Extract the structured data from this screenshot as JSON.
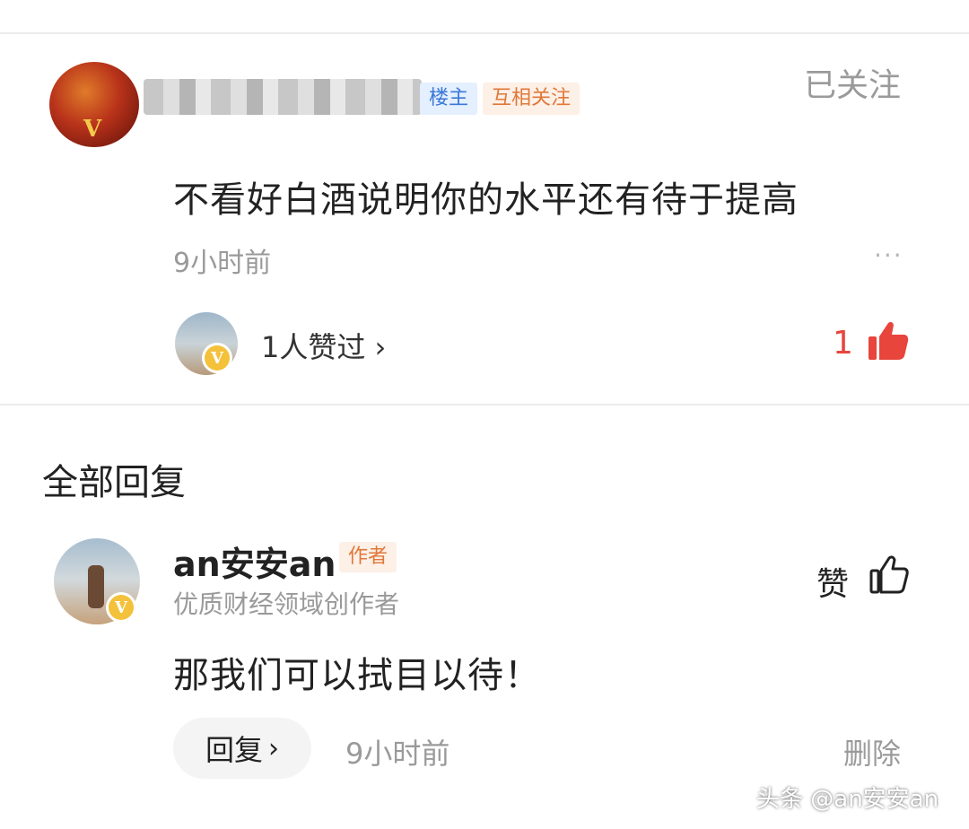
{
  "comment": {
    "owner_tag": "楼主",
    "mutual_tag": "互相关注",
    "follow_status": "已关注",
    "text": "不看好白酒说明你的水平还有待于提高",
    "time": "9小时前",
    "more_icon": "···",
    "likers_text": "1人赞过 ›",
    "like_count": "1"
  },
  "replies_section": {
    "title": "全部回复"
  },
  "reply": {
    "name": "an安安an",
    "author_tag": "作者",
    "description": "优质财经领域创作者",
    "like_label": "赞",
    "text": "那我们可以拭目以待！",
    "reply_button_label": "回复",
    "reply_chevron": "›",
    "time": "9小时前",
    "delete_label": "删除"
  },
  "badge": {
    "letter": "V"
  },
  "watermark": "头条 @an安安an",
  "colors": {
    "like_red": "#e8453c",
    "owner_tag_blue": "#3a78d8",
    "tag_orange": "#e0783a",
    "badge_gold": "#f3c13a"
  },
  "icons": [
    "more-icon",
    "thumb-up-filled-icon",
    "thumb-up-outline-icon",
    "chevron-right-icon",
    "verified-v-icon"
  ]
}
